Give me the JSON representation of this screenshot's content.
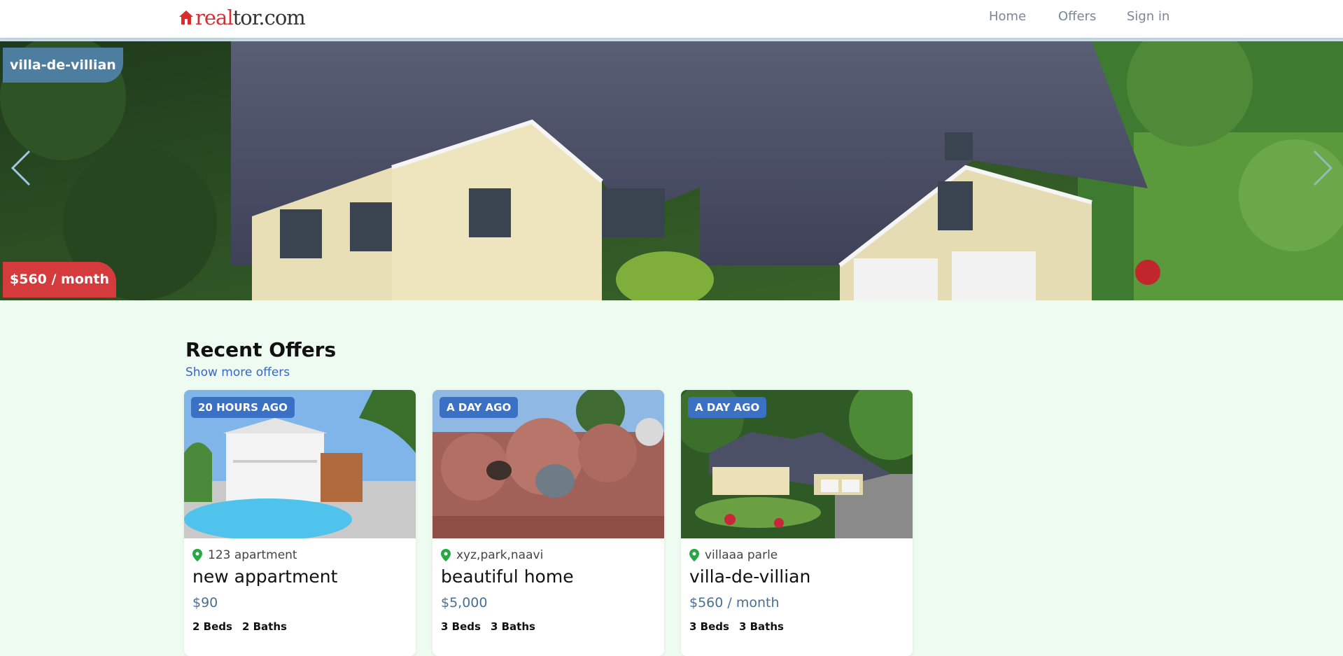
{
  "brand": {
    "logo_text_part1": "real",
    "logo_text_part2": "tor.com",
    "logo_icon": "house-icon"
  },
  "nav": [
    {
      "label": "Home"
    },
    {
      "label": "Offers"
    },
    {
      "label": "Sign in"
    }
  ],
  "hero": {
    "name": "villa-de-villian",
    "price": "$560 / month",
    "prev_icon": "chevron-left-icon",
    "next_icon": "chevron-right-icon"
  },
  "section": {
    "title": "Recent Offers",
    "show_more": "Show more offers"
  },
  "offers": [
    {
      "time": "20 HOURS AGO",
      "address": "123 apartment",
      "name": "new appartment",
      "price": "$90",
      "beds": "2 Beds",
      "baths": "2 Baths"
    },
    {
      "time": "A DAY AGO",
      "address": "xyz,park,naavi",
      "name": "beautiful home",
      "price": "$5,000",
      "beds": "3 Beds",
      "baths": "3 Baths"
    },
    {
      "time": "A DAY AGO",
      "address": "villaaa parle",
      "name": "villa-de-villian",
      "price": "$560 / month",
      "beds": "3 Beds",
      "baths": "3 Baths"
    }
  ],
  "colors": {
    "brand_red": "#d62e2f",
    "accent_blue": "#3a71c4",
    "page_bg": "#edfbf1",
    "price_red": "#d53a3c"
  }
}
